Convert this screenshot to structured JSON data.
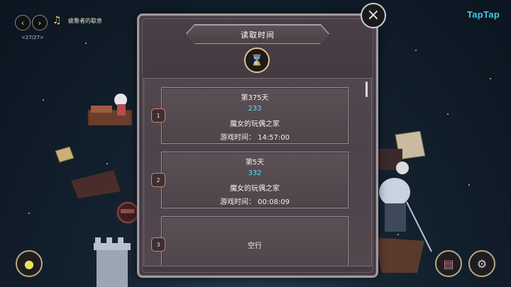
{
  "music_player": {
    "prev_icon": "chevron-left-icon",
    "next_icon": "chevron-right-icon",
    "note_icon": "music-note-icon",
    "song_title": "疲惫者的歇息",
    "track_counter": "<27/27>"
  },
  "brand": {
    "logo_text": "TapTap",
    "color": "#3cc9e6"
  },
  "dialog": {
    "title": "读取时间",
    "emblem_icon": "scroll-hourglass-icon",
    "close_icon": "close-icon",
    "accent_count_color": "#5de0ec",
    "slot_border_color": "#e07c6a"
  },
  "slots": [
    {
      "number": "1",
      "day": "第375天",
      "count": "233",
      "location": "魔女的玩偶之家",
      "playtime": "游戏时间： 14:57:00"
    },
    {
      "number": "2",
      "day": "第5天",
      "count": "332",
      "location": "魔女的玩偶之家",
      "playtime": "游戏时间： 00:08:09"
    },
    {
      "number": "3",
      "empty_label": "空行"
    }
  ],
  "corner_buttons": {
    "bottom_left_icon": "character-portrait-icon",
    "bottom_right_1_icon": "journal-icon",
    "bottom_right_2_icon": "gear-icon"
  }
}
